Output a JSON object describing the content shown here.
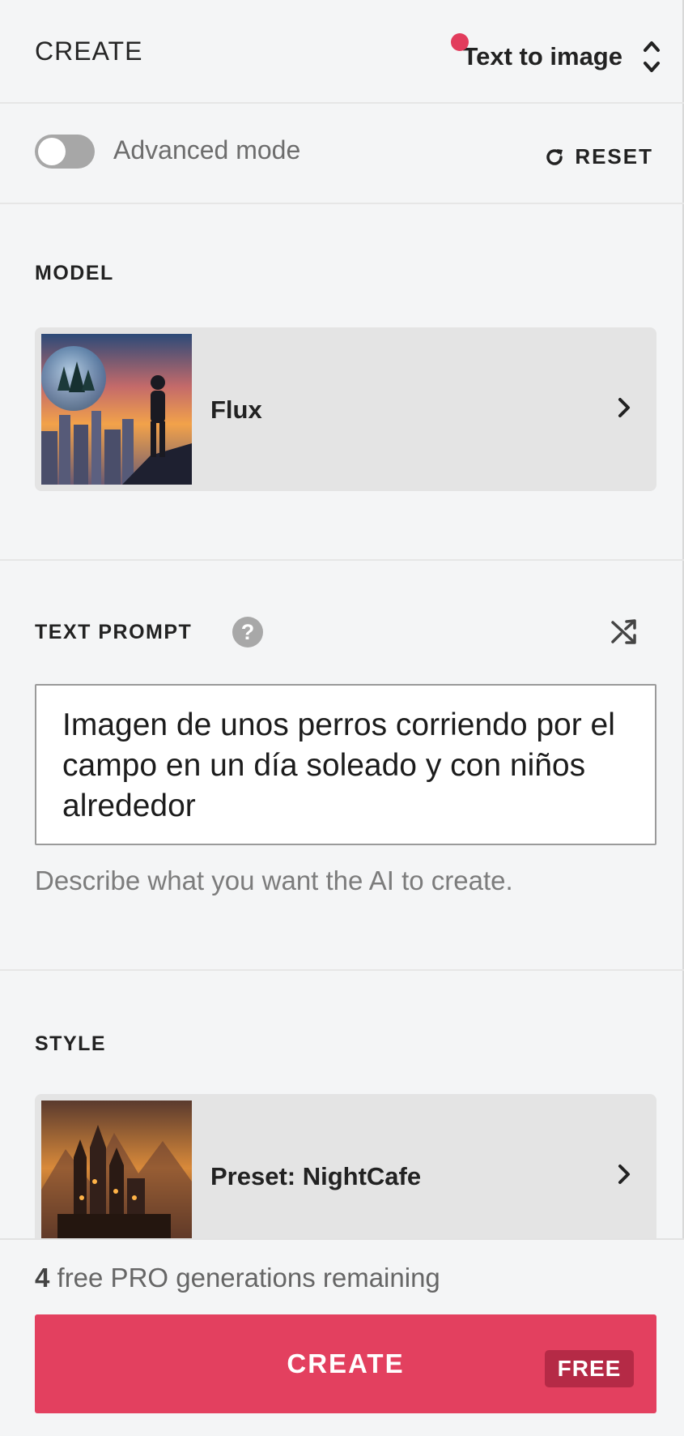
{
  "header": {
    "title": "CREATE",
    "mode_label": "Text to image"
  },
  "settings": {
    "advanced_mode_label": "Advanced mode",
    "advanced_mode_on": false,
    "reset_label": "RESET"
  },
  "model": {
    "section_label": "MODEL",
    "name": "Flux"
  },
  "prompt": {
    "section_label": "TEXT PROMPT",
    "help_glyph": "?",
    "value": "Imagen de unos perros corriendo por el campo en un día soleado y con niños alrededor",
    "helper_text": "Describe what you want the AI to create."
  },
  "style": {
    "section_label": "STYLE",
    "name": "Preset: NightCafe"
  },
  "footer": {
    "free_count": "4",
    "free_text": " free PRO generations remaining",
    "create_label": "CREATE",
    "badge_label": "FREE"
  },
  "colors": {
    "accent": "#e3405f",
    "badge": "#b52a46",
    "notification_dot": "#e23c5c"
  }
}
